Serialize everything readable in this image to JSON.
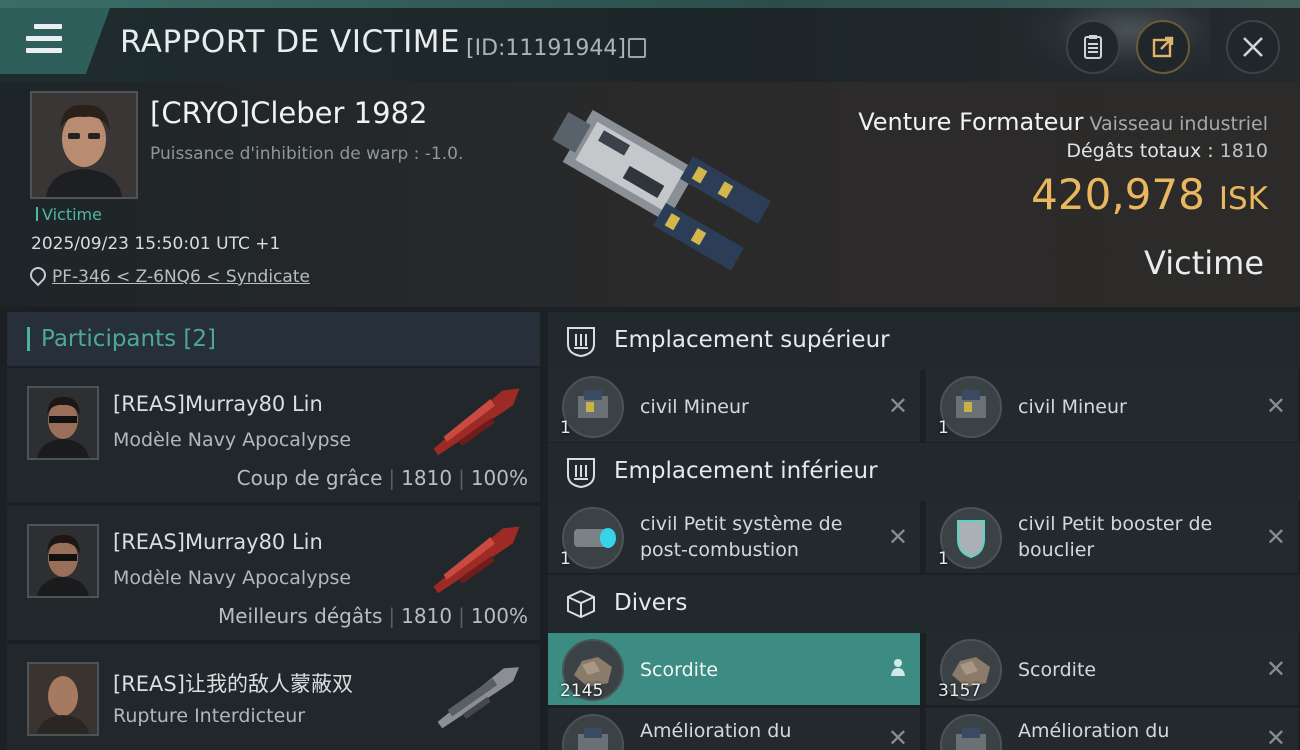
{
  "header": {
    "title": "RAPPORT DE VICTIME",
    "report_id": "[ID:11191944]"
  },
  "victim": {
    "name": "[CRYO]Cleber 1982",
    "warp_disruption": "Puissance d'inhibition de warp : -1.0.",
    "role_tag": "Victime",
    "datetime": "2025/09/23 15:50:01 UTC +1",
    "location": "PF-346 < Z-6NQ6 < Syndicate",
    "ship_name": "Venture Formateur",
    "ship_class": "Vaisseau industriel",
    "damage_label": "Dégâts totaux :",
    "damage_value": "1810",
    "isk_value": "420,978",
    "isk_unit": "ISK",
    "status_label": "Victime"
  },
  "participants": {
    "title": "Participants",
    "count": "[2]",
    "rows": [
      {
        "name": "[REAS]Murray80 Lin",
        "ship": "Modèle Navy Apocalypse",
        "stat_label": "Coup de grâce",
        "damage": "1810",
        "percent": "100%"
      },
      {
        "name": "[REAS]Murray80 Lin",
        "ship": "Modèle Navy Apocalypse",
        "stat_label": "Meilleurs dégâts",
        "damage": "1810",
        "percent": "100%"
      },
      {
        "name": "[REAS]让我的敌人蒙蔽双",
        "ship": "Rupture Interdicteur"
      }
    ]
  },
  "slots": {
    "high": {
      "title": "Emplacement supérieur",
      "items": [
        {
          "name": "civil Mineur",
          "qty": "1"
        },
        {
          "name": "civil Mineur",
          "qty": "1"
        }
      ]
    },
    "low": {
      "title": "Emplacement inférieur",
      "items": [
        {
          "name_line1": "civil Petit système de",
          "name_line2": "post-combustion",
          "qty": "1"
        },
        {
          "name_line1": "civil Petit booster de",
          "name_line2": "bouclier",
          "qty": "1"
        }
      ]
    },
    "misc": {
      "title": "Divers",
      "items": [
        {
          "name": "Scordite",
          "qty": "2145"
        },
        {
          "name": "Scordite",
          "qty": "3157"
        },
        {
          "name": "Amélioration du"
        },
        {
          "name": "Amélioration du"
        }
      ]
    }
  },
  "icons": {
    "close": "✕",
    "accent": "#4bb2a3",
    "isk_color": "#e8b760"
  }
}
